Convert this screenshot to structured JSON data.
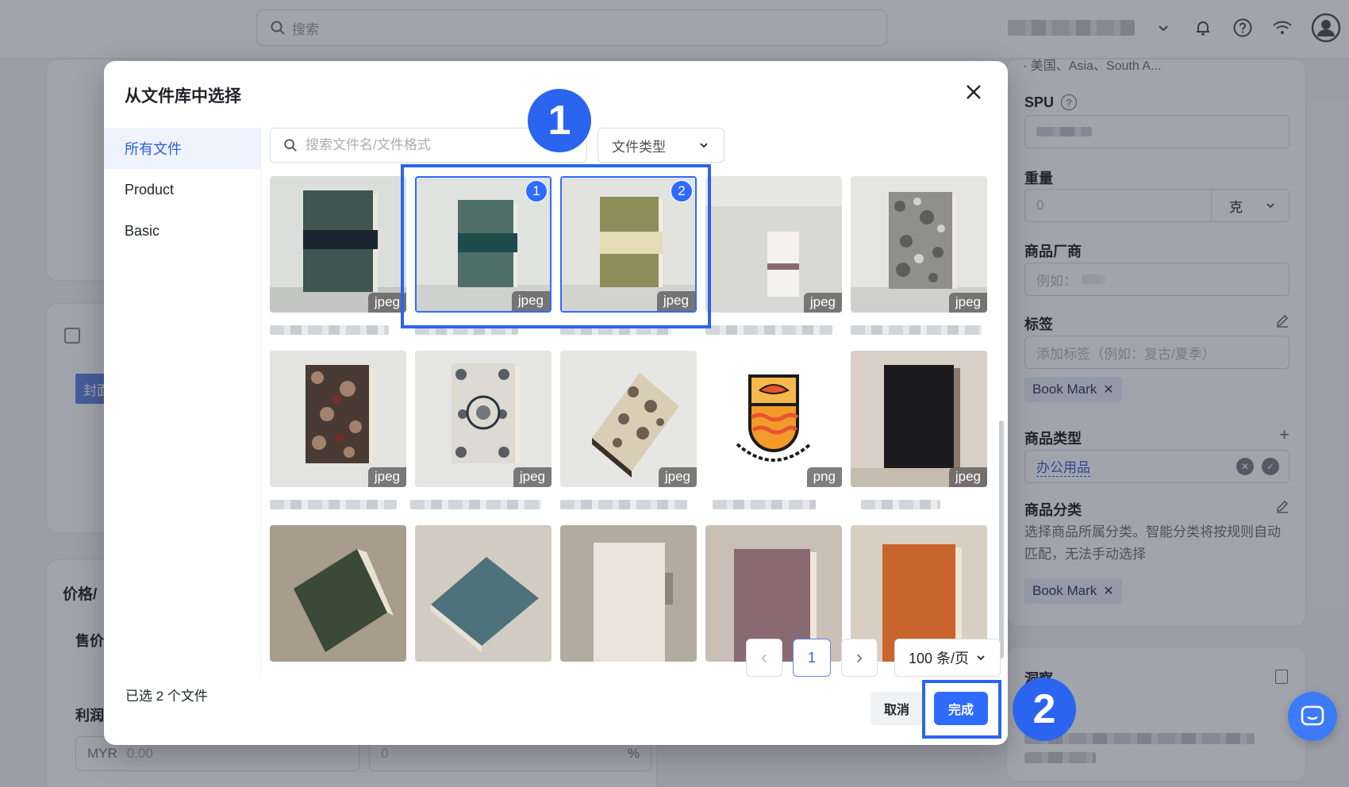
{
  "app": {
    "search_placeholder": "搜索",
    "right_panel": {
      "region_text": "· 美国、Asia、South A...",
      "spu_label": "SPU",
      "weight_label": "重量",
      "weight_value": "0",
      "weight_unit": "克",
      "vendor_label": "商品厂商",
      "vendor_placeholder": "例如：",
      "tags_label": "标签",
      "tags_placeholder": "添加标签（例如：复古/夏季）",
      "tag_chip": "Book Mark",
      "product_type_label": "商品类型",
      "product_type_value": "办公用品",
      "category_label": "商品分类",
      "category_hint": "选择商品所属分类。智能分类将按规则自动匹配，无法手动选择",
      "category_chip": "Book Mark",
      "insight_label": "洞察"
    },
    "left_bg": {
      "price_label": "价格/",
      "sale_label": "售价",
      "profit_label": "利润",
      "currency": "MYR",
      "amount": "0.00",
      "margin": "0",
      "percent": "%",
      "cover_label": "封面"
    }
  },
  "modal": {
    "title": "从文件库中选择",
    "nav": [
      {
        "label": "所有文件",
        "active": true
      },
      {
        "label": "Product",
        "active": false
      },
      {
        "label": "Basic",
        "active": false
      }
    ],
    "search_placeholder": "搜索文件名/文件格式",
    "file_type_label": "文件类型",
    "files": [
      {
        "ext": "jpeg",
        "selected": false
      },
      {
        "ext": "jpeg",
        "selected": true,
        "order": "1"
      },
      {
        "ext": "jpeg",
        "selected": true,
        "order": "2"
      },
      {
        "ext": "jpeg",
        "selected": false
      },
      {
        "ext": "jpeg",
        "selected": false
      },
      {
        "ext": "jpeg",
        "selected": false
      },
      {
        "ext": "jpeg",
        "selected": false
      },
      {
        "ext": "jpeg",
        "selected": false
      },
      {
        "ext": "png",
        "selected": false
      },
      {
        "ext": "jpeg",
        "selected": false
      },
      {
        "ext": "",
        "selected": false
      },
      {
        "ext": "",
        "selected": false
      },
      {
        "ext": "",
        "selected": false
      },
      {
        "ext": "",
        "selected": false
      },
      {
        "ext": "",
        "selected": false
      }
    ],
    "pagination": {
      "prev": "‹",
      "current": "1",
      "next": "›",
      "page_size": "100 条/页"
    },
    "selected_count_text": "已选 2 个文件",
    "cancel_label": "取消",
    "done_label": "完成"
  },
  "annotations": {
    "step1": "1",
    "step2": "2"
  },
  "colors": {
    "accent": "#2f6bff",
    "annotation": "#2b64ee",
    "tag_bg": "#e8eefc"
  }
}
